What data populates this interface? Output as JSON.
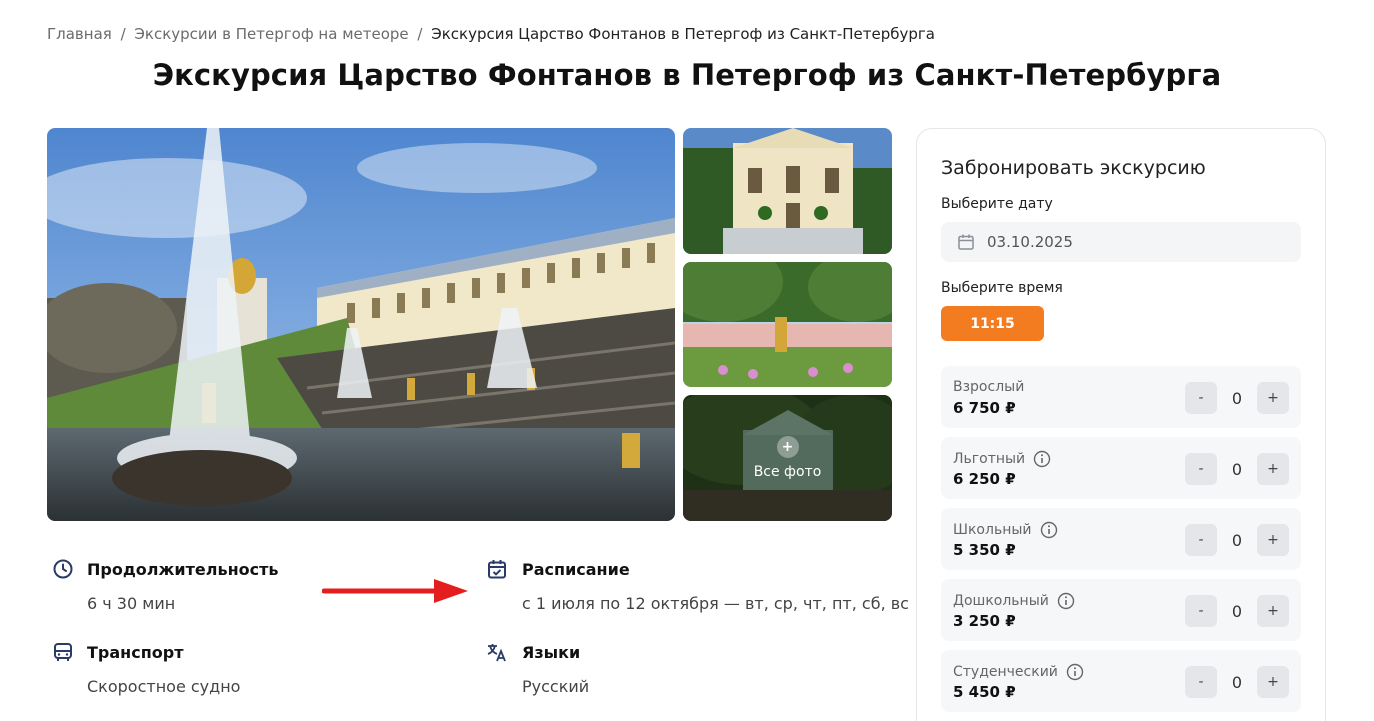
{
  "breadcrumb": {
    "home": "Главная",
    "separator": "/",
    "category": "Экскурсии в Петергоф на метеоре",
    "current": "Экскурсия Царство Фонтанов в Петергоф из Санкт-Петербурга"
  },
  "page_title": "Экскурсия Царство Фонтанов в Петергоф из Санкт-Петербурга",
  "gallery": {
    "all_photos_plus": "+",
    "all_photos_label": "Все фото"
  },
  "details": {
    "duration": {
      "title": "Продолжительность",
      "value": "6 ч 30 мин",
      "icon": "clock-icon"
    },
    "schedule": {
      "title": "Расписание",
      "value": "с 1 июля по 12 октября — вт, ср, чт, пт, сб, вс",
      "icon": "calendar-check-icon"
    },
    "transport": {
      "title": "Транспорт",
      "value": "Скоростное судно",
      "icon": "bus-icon"
    },
    "languages": {
      "title": "Языки",
      "value": "Русский",
      "icon": "translate-icon"
    }
  },
  "booking": {
    "title": "Забронировать экскурсию",
    "date_label": "Выберите дату",
    "date_value": "03.10.2025",
    "time_label": "Выберите время",
    "time_value": "11:15",
    "accent_color": "#f47c20",
    "tickets": [
      {
        "name": "Взрослый",
        "price": "6 750 ₽",
        "qty": "0",
        "has_info": false
      },
      {
        "name": "Льготный",
        "price": "6 250 ₽",
        "qty": "0",
        "has_info": true
      },
      {
        "name": "Школьный",
        "price": "5 350 ₽",
        "qty": "0",
        "has_info": true
      },
      {
        "name": "Дошкольный",
        "price": "3 250 ₽",
        "qty": "0",
        "has_info": true
      },
      {
        "name": "Студенческий",
        "price": "5 450 ₽",
        "qty": "0",
        "has_info": true
      }
    ],
    "minus": "-",
    "plus": "+"
  },
  "annotation_arrow_color": "#e41e1e"
}
